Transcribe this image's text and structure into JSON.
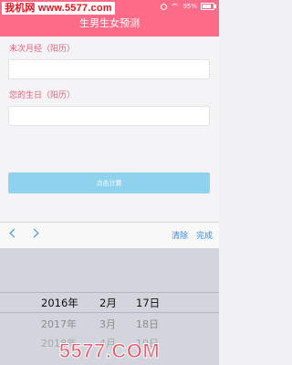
{
  "watermark_top": "我机网 www.5577.com",
  "status": {
    "battery": "95%"
  },
  "header": {
    "title": "生男生女预测"
  },
  "form": {
    "period_label": "末次月经（阳历）",
    "period_value": "",
    "birthday_label": "您的生日（阳历）",
    "birthday_value": "",
    "calculate_label": "点击计算"
  },
  "toolbar": {
    "prev_icon": "chevron-left-icon",
    "next_icon": "chevron-right-icon",
    "clear_label": "清除",
    "done_label": "完成"
  },
  "picker": {
    "rows": [
      {
        "year": "2016年",
        "month": "2月",
        "day": "17日"
      },
      {
        "year": "2017年",
        "month": "3月",
        "day": "18日"
      },
      {
        "year": "2018年",
        "month": "4月",
        "day": "19日"
      }
    ]
  },
  "watermark_bottom": "5577.COM",
  "colors": {
    "header": "#fc6c88",
    "accent": "#2d89ef",
    "button": "#8fd2ee",
    "label": "#e0627c"
  }
}
